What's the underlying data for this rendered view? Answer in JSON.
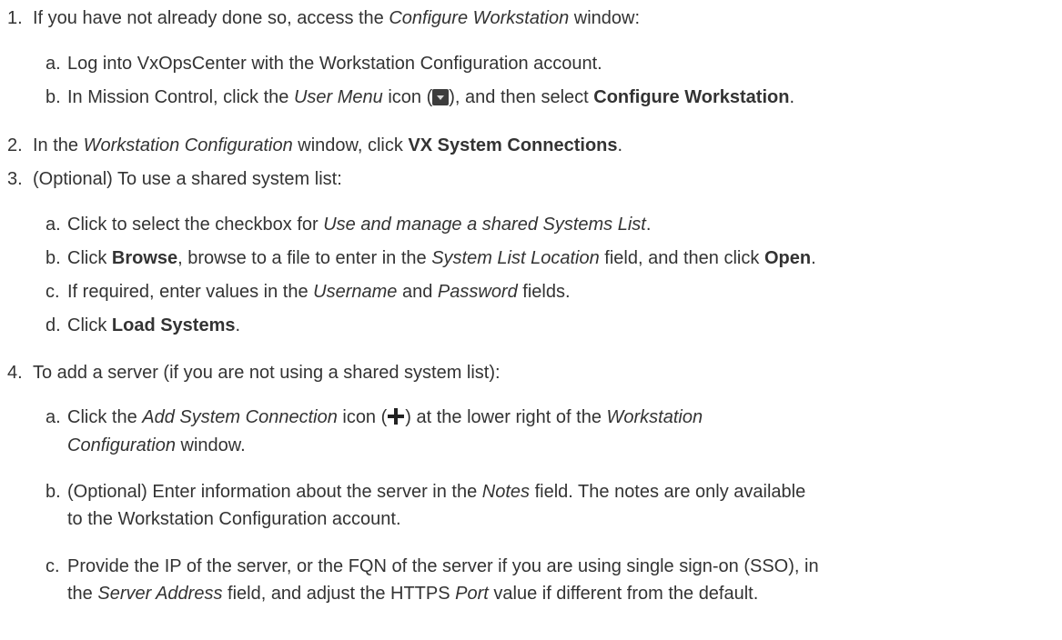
{
  "steps": [
    {
      "number": "1.",
      "segments": [
        "If you have not already done so, access the ",
        "Configure Workstation",
        " window:"
      ],
      "substeps": [
        {
          "letter": "a.",
          "segments": [
            "Log into VxOpsCenter with the Workstation Configuration account."
          ]
        },
        {
          "letter": "b.",
          "segments": [
            "In Mission Control, click the ",
            "User Menu",
            " icon (",
            "), and then select ",
            "Configure Workstation",
            "."
          ],
          "icon": "dropdown-arrow-icon"
        }
      ]
    },
    {
      "number": "2.",
      "segments": [
        "In the ",
        "Workstation Configuration",
        " window, click ",
        "VX System Connections",
        "."
      ]
    },
    {
      "number": "3.",
      "segments": [
        "(Optional) To use a shared system list:"
      ],
      "substeps": [
        {
          "letter": "a.",
          "segments": [
            "Click to select the checkbox for ",
            "Use and manage a shared Systems List",
            "."
          ]
        },
        {
          "letter": "b.",
          "segments": [
            "Click ",
            "Browse",
            ", browse to a file to enter in the ",
            "System List Location",
            " field, and then click ",
            "Open",
            "."
          ]
        },
        {
          "letter": "c.",
          "segments": [
            "If required, enter values in the ",
            "Username",
            " and ",
            "Password",
            " fields."
          ]
        },
        {
          "letter": "d.",
          "segments": [
            "Click ",
            "Load Systems",
            "."
          ]
        }
      ]
    },
    {
      "number": "4.",
      "segments": [
        "To add a server (if you are not using a shared system list):"
      ],
      "substeps": [
        {
          "letter": "a.",
          "segments": [
            "Click the ",
            "Add System Connection",
            " icon (",
            ") at the lower right of the ",
            "Workstation",
            "Configuration",
            " window."
          ],
          "icon": "plus-icon"
        },
        {
          "letter": "b.",
          "segments": [
            "(Optional) Enter information about the server in the ",
            "Notes",
            " field. The notes are only available",
            "to the Workstation Configuration account."
          ]
        },
        {
          "letter": "c.",
          "segments": [
            "Provide the IP of the server, or the FQN of the server if you are using single sign-on (SSO), in",
            "the ",
            "Server Address",
            " field, and adjust the HTTPS ",
            "Port",
            " value if different from the default."
          ]
        }
      ]
    }
  ]
}
